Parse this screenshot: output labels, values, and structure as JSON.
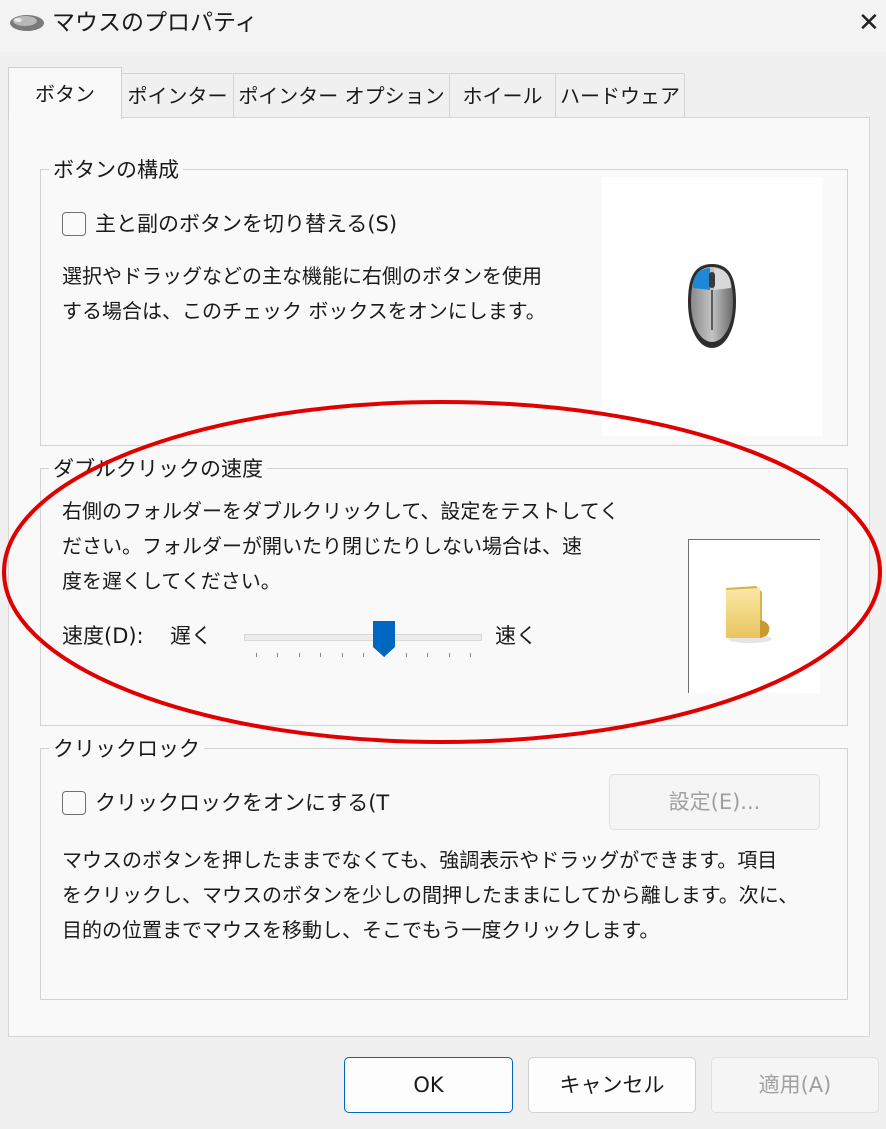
{
  "window": {
    "title": "マウスのプロパティ",
    "close_glyph": "✕"
  },
  "tabs": [
    {
      "label": "ボタン",
      "active": true
    },
    {
      "label": "ポインター",
      "active": false
    },
    {
      "label": "ポインター オプション",
      "active": false
    },
    {
      "label": "ホイール",
      "active": false
    },
    {
      "label": "ハードウェア",
      "active": false
    }
  ],
  "button_config": {
    "title": "ボタンの構成",
    "swap_label": "主と副のボタンを切り替える(S)",
    "swap_checked": false,
    "desc_line1": "選択やドラッグなどの主な機能に右側のボタンを使用",
    "desc_line2": "する場合は、このチェック ボックスをオンにします。"
  },
  "double_click": {
    "title": "ダブルクリックの速度",
    "desc_line1": "右側のフォルダーをダブルクリックして、設定をテストしてく",
    "desc_line2": "ださい。フォルダーが開いたり閉じたりしない場合は、速",
    "desc_line3": "度を遅くしてください。",
    "speed_label": "速度(D):",
    "slow_label": "遅く",
    "fast_label": "速く",
    "slider_level": 0.6
  },
  "click_lock": {
    "title": "クリックロック",
    "enable_label": "クリックロックをオンにする(T",
    "enable_checked": false,
    "settings_button": "設定(E)...",
    "desc_line1": "マウスのボタンを押したままでなくても、強調表示やドラッグができます。項目",
    "desc_line2": "をクリックし、マウスのボタンを少しの間押したままにしてから離します。次に、",
    "desc_line3": "目的の位置までマウスを移動し、そこでもう一度クリックします。"
  },
  "footer": {
    "ok": "OK",
    "cancel": "キャンセル",
    "apply": "適用(A)"
  },
  "colors": {
    "accent": "#0067c0",
    "annotation": "#e00000"
  }
}
